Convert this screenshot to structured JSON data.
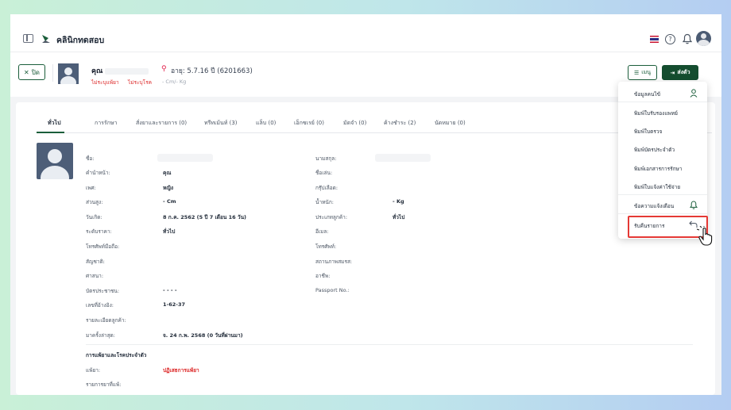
{
  "app": {
    "title": "คลินิกทดสอบ"
  },
  "patient": {
    "name_prefix": "คุณ",
    "age": "อายุ: 5.7.16 ปี",
    "hn": "(6201663)",
    "tag_allergy": "ไม่ระบุแพ้ยา",
    "tag_disease": "ไม่ระบุโรค",
    "weight": "- Cm/- Kg"
  },
  "actions": {
    "close": "ปิด",
    "menu": "เมนู",
    "send": "ส่งตัว"
  },
  "tabs": [
    {
      "label": "ทั่วไป",
      "active": true
    },
    {
      "label": "การรักษา"
    },
    {
      "label": "สั่งยาและรายการ (0)"
    },
    {
      "label": "ทรีทเม้นท์ (3)"
    },
    {
      "label": "แล็บ (0)"
    },
    {
      "label": "เอ็กซเรย์ (0)"
    },
    {
      "label": "มัดจำ (0)"
    },
    {
      "label": "ค้างชำระ (2)"
    },
    {
      "label": "นัดหมาย (0)"
    }
  ],
  "fields_left": [
    {
      "label": "ชื่อ:",
      "value": ""
    },
    {
      "label": "คำนำหน้า:",
      "value": "คุณ"
    },
    {
      "label": "เพศ:",
      "value": "หญิง"
    },
    {
      "label": "ส่วนสูง:",
      "value": "- Cm"
    },
    {
      "label": "วันเกิด:",
      "value": "8 ก.ค. 2562 (5 ปี 7 เดือน 16 วัน)"
    },
    {
      "label": "ระดับราคา:",
      "value": "ทั่วไป"
    },
    {
      "label": "โทรศัพท์มือถือ:",
      "value": ""
    },
    {
      "label": "สัญชาติ:",
      "value": ""
    },
    {
      "label": "ศาสนา:",
      "value": ""
    },
    {
      "label": "บัตรประชาชน:",
      "value": "- - - -"
    },
    {
      "label": "เลขที่อ้างอิง:",
      "value": "1-62-37"
    },
    {
      "label": "รายละเอียดลูกค้า:",
      "value": ""
    },
    {
      "label": "มาครั้งล่าสุด:",
      "value": "จ. 24 ก.พ. 2568 (0 วันที่ผ่านมา)"
    }
  ],
  "fields_right": [
    {
      "label": "นามสกุล:",
      "value": ""
    },
    {
      "label": "ชื่อเล่น:",
      "value": ""
    },
    {
      "label": "กรุ๊ปเลือด:",
      "value": ""
    },
    {
      "label": "น้ำหนัก:",
      "value": "- Kg"
    },
    {
      "label": "ประเภทลูกค้า:",
      "value": "ทั่วไป"
    },
    {
      "label": "อีเมล:",
      "value": ""
    },
    {
      "label": "โทรศัพท์:",
      "value": ""
    },
    {
      "label": "สถานภาพสมรส:",
      "value": ""
    },
    {
      "label": "อาชีพ:",
      "value": ""
    },
    {
      "label": "Passport No.:",
      "value": ""
    }
  ],
  "allergy_section": {
    "title": "การแพ้ยาและโรคประจำตัว",
    "allergy_label": "แพ้ยา:",
    "allergy_value": "ปฏิเสธการแพ้ยา",
    "disease_label": "รายการยาที่แพ้:"
  },
  "dropdown": {
    "items": [
      {
        "label": "ข้อมูลคนไข้",
        "icon": "user-icon"
      },
      {
        "label": "พิมพ์ใบรับรองแพทย์"
      },
      {
        "label": "พิมพ์ใบตรวจ"
      },
      {
        "label": "พิมพ์บัตรประจำตัว"
      },
      {
        "label": "พิมพ์เอกสารการรักษา"
      },
      {
        "label": "พิมพ์ใบแจ้งค่าใช้จ่าย"
      },
      {
        "label": "ข้อความแจ้งเตือน",
        "icon": "bell-icon"
      },
      {
        "label": "รับคืนรายการ",
        "icon": "return-icon"
      }
    ]
  },
  "colors": {
    "primary": "#144d2f",
    "danger": "#dc2626",
    "highlight": "#e53935"
  }
}
